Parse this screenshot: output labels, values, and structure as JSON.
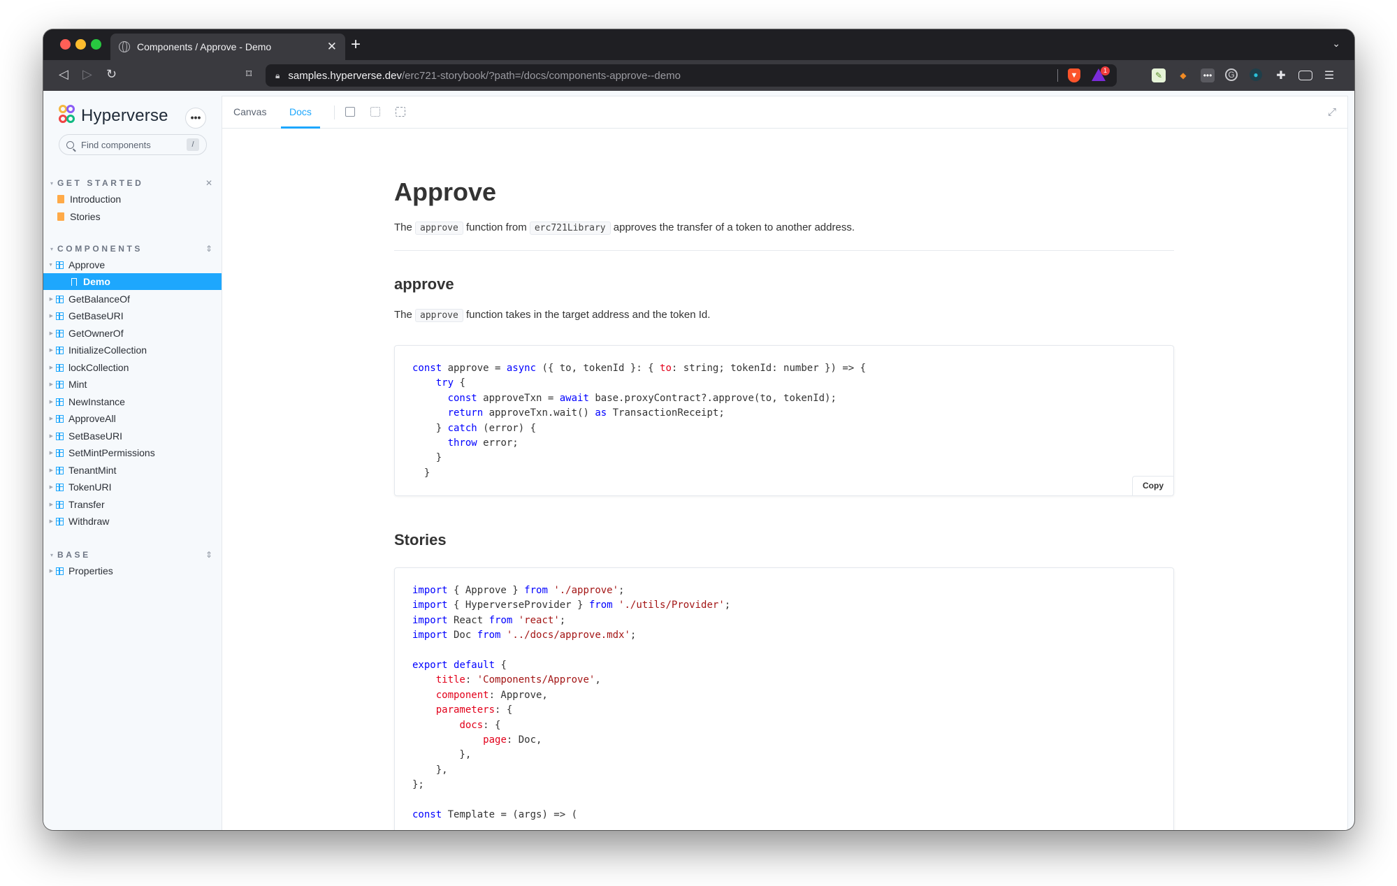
{
  "browser": {
    "tab_title": "Components / Approve - Demo",
    "url_host": "samples.hyperverse.dev",
    "url_path": "/erc721-storybook/?path=/docs/components-approve--demo",
    "shields_badge": "1"
  },
  "sidebar": {
    "brand": "Hyperverse",
    "search_placeholder": "Find components",
    "search_shortcut": "/",
    "sections": [
      {
        "label": "GET STARTED",
        "items": [
          "Introduction",
          "Stories"
        ]
      },
      {
        "label": "COMPONENTS",
        "items": [
          "Approve",
          "Demo",
          "GetBalanceOf",
          "GetBaseURI",
          "GetOwnerOf",
          "InitializeCollection",
          "lockCollection",
          "Mint",
          "NewInstance",
          "ApproveAll",
          "SetBaseURI",
          "SetMintPermissions",
          "TenantMint",
          "TokenURI",
          "Transfer",
          "Withdraw"
        ]
      },
      {
        "label": "BASE",
        "items": [
          "Properties"
        ]
      }
    ],
    "active_item": "Demo"
  },
  "toolbar": {
    "tabs": [
      "Canvas",
      "Docs"
    ],
    "active_tab": "Docs"
  },
  "doc": {
    "title": "Approve",
    "intro": {
      "pre": "The ",
      "code1": "approve",
      "mid": " function from ",
      "code2": "erc721Library",
      "post": " approves the transfer of a token to another address."
    },
    "section1_title": "approve",
    "section1_para": {
      "pre": "The ",
      "code": "approve",
      "post": " function takes in the target address and the token Id."
    },
    "copy_label": "Copy",
    "section2_title": "Stories"
  }
}
